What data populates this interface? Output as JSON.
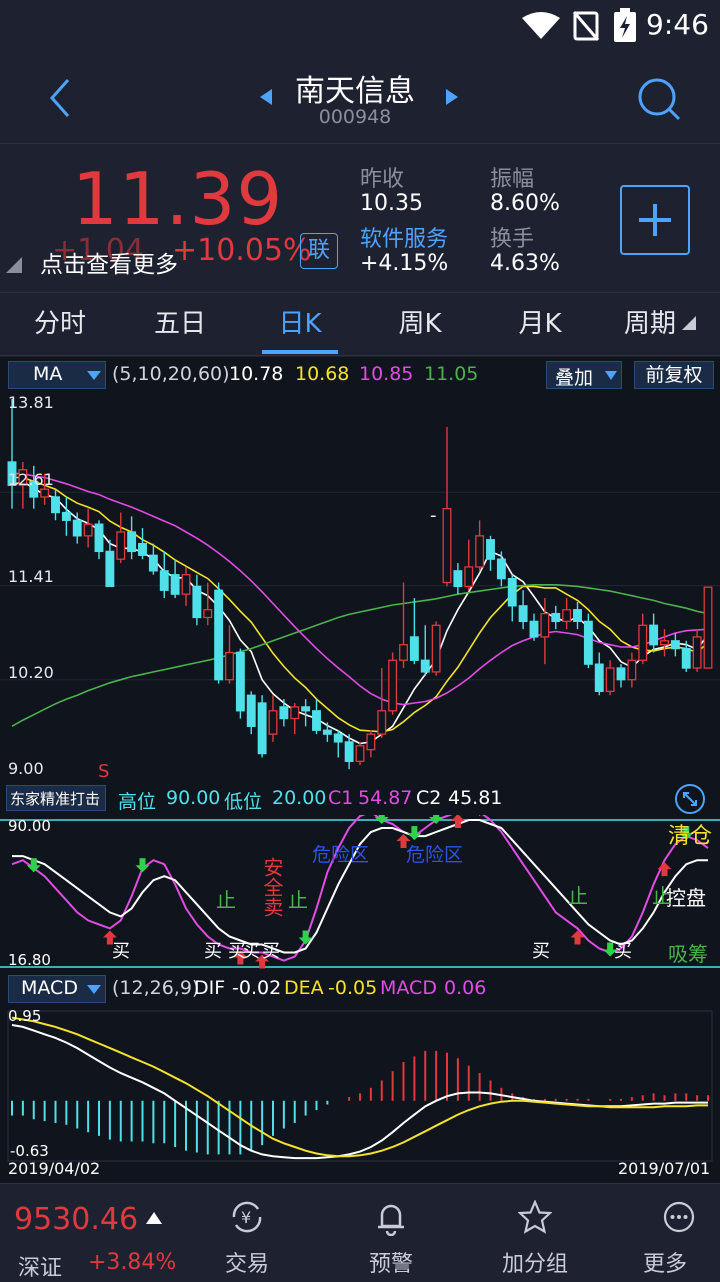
{
  "status_bar": {
    "time": "9:46"
  },
  "nav": {
    "title": "南天信息",
    "code": "000948"
  },
  "quote": {
    "price": "11.39",
    "change": "+1.04",
    "change_pct": "+10.05%",
    "link_badge": "联",
    "tooltip": "点击查看更多",
    "prev_close_label": "昨收",
    "prev_close_value": "10.35",
    "amplitude_label": "振幅",
    "amplitude_value": "8.60%",
    "sector_label": "软件服务",
    "sector_value": "+4.15%",
    "turnover_label": "换手",
    "turnover_value": "4.63%"
  },
  "tabs": [
    "分时",
    "五日",
    "日K",
    "周K",
    "月K",
    "周期"
  ],
  "active_tab": 2,
  "ma_panel": {
    "indicator": "MA",
    "params": "(5,10,20,60)",
    "ma5": "10.78",
    "ma10": "10.68",
    "ma20": "10.85",
    "ma60": "11.05",
    "overlay_btn": "叠加",
    "adjust_btn": "前复权",
    "y_labels": [
      "13.81",
      "12.61",
      "11.41",
      "10.20",
      "9.00"
    ],
    "signal_s": "S",
    "high_marker": "-"
  },
  "osc_panel": {
    "name": "东家精准打击",
    "high_label": "高位",
    "high_value": "90.00",
    "low_label": "低位",
    "low_value": "20.00",
    "c1_label": "C1",
    "c1_value": "54.87",
    "c2_label": "C2",
    "c2_value": "45.81",
    "y_top": "90.00",
    "y_bottom": "16.80",
    "tag_clear": "清仓",
    "tag_control": "控盘",
    "tag_absorb": "吸筹",
    "annotations": [
      "买",
      "买",
      "买",
      "买",
      "买",
      "买",
      "买",
      "止",
      "止",
      "止",
      "止",
      "安全卖",
      "危险区",
      "危险区"
    ]
  },
  "macd_panel": {
    "indicator": "MACD",
    "params": "(12,26,9)",
    "dif_label": "DIF",
    "dif_value": "-0.02",
    "dea_label": "DEA",
    "dea_value": "-0.05",
    "macd_label": "MACD",
    "macd_value": "0.06",
    "y_top": "0.95",
    "y_bottom": "-0.63",
    "date_start": "2019/04/02",
    "date_end": "2019/07/01"
  },
  "bottom": {
    "index_value": "9530.46",
    "index_name": "深证",
    "index_change": "+3.84%",
    "nav_items": [
      "交易",
      "预警",
      "加分组",
      "更多"
    ]
  },
  "colors": {
    "up": "#e0393e",
    "down": "#4fe0ea",
    "accent": "#4da3ff",
    "ma5": "#ffffff",
    "ma10": "#f4e22c",
    "ma20": "#e14ce6",
    "ma60": "#4bb34b"
  },
  "chart_data": [
    {
      "type": "candlestick",
      "title": "",
      "x_range": [
        "2019/04/02",
        "2019/07/01"
      ],
      "ylim": [
        9.0,
        13.81
      ],
      "ohlc": [
        [
          13.0,
          12.7,
          13.81,
          12.4
        ],
        [
          12.7,
          12.9,
          13.0,
          12.4
        ],
        [
          12.75,
          12.55,
          12.95,
          12.4
        ],
        [
          12.55,
          12.65,
          12.85,
          12.45
        ],
        [
          12.55,
          12.35,
          12.65,
          12.25
        ],
        [
          12.35,
          12.25,
          12.55,
          12.05
        ],
        [
          12.25,
          12.05,
          12.35,
          11.95
        ],
        [
          12.05,
          12.2,
          12.4,
          11.9
        ],
        [
          12.2,
          11.85,
          12.25,
          11.75
        ],
        [
          11.85,
          11.4,
          12.0,
          11.4
        ],
        [
          11.75,
          12.1,
          12.35,
          11.7
        ],
        [
          12.1,
          11.85,
          12.3,
          11.75
        ],
        [
          11.95,
          11.8,
          12.15,
          11.75
        ],
        [
          11.8,
          11.6,
          11.95,
          11.55
        ],
        [
          11.6,
          11.35,
          11.85,
          11.25
        ],
        [
          11.55,
          11.3,
          11.75,
          11.25
        ],
        [
          11.3,
          11.55,
          11.65,
          11.15
        ],
        [
          11.4,
          11.0,
          11.55,
          10.9
        ],
        [
          11.0,
          11.1,
          11.45,
          10.9
        ],
        [
          11.35,
          10.2,
          11.45,
          10.15
        ],
        [
          10.2,
          10.55,
          10.9,
          10.15
        ],
        [
          10.55,
          9.8,
          10.6,
          9.7
        ],
        [
          10.0,
          9.6,
          10.05,
          9.5
        ],
        [
          9.9,
          9.25,
          10.0,
          9.2
        ],
        [
          9.5,
          9.8,
          10.0,
          9.4
        ],
        [
          9.85,
          9.7,
          9.95,
          9.6
        ],
        [
          9.7,
          9.85,
          9.9,
          9.5
        ],
        [
          9.85,
          9.8,
          9.95,
          9.6
        ],
        [
          9.8,
          9.55,
          9.95,
          9.5
        ],
        [
          9.55,
          9.5,
          9.65,
          9.4
        ],
        [
          9.5,
          9.4,
          9.55,
          9.2
        ],
        [
          9.4,
          9.15,
          9.5,
          9.05
        ],
        [
          9.15,
          9.35,
          9.4,
          9.1
        ],
        [
          9.3,
          9.5,
          9.55,
          9.2
        ],
        [
          9.5,
          9.8,
          10.35,
          9.45
        ],
        [
          9.8,
          10.45,
          10.55,
          9.75
        ],
        [
          10.45,
          10.65,
          11.45,
          10.35
        ],
        [
          10.75,
          10.45,
          11.25,
          10.4
        ],
        [
          10.45,
          10.3,
          10.9,
          10.25
        ],
        [
          10.3,
          10.9,
          10.95,
          10.25
        ],
        [
          11.45,
          12.4,
          13.45,
          11.4
        ],
        [
          11.6,
          11.4,
          11.7,
          11.3
        ],
        [
          11.4,
          11.65,
          12.0,
          11.35
        ],
        [
          11.65,
          12.05,
          12.25,
          11.6
        ],
        [
          12.0,
          11.75,
          12.05,
          11.6
        ],
        [
          11.75,
          11.5,
          11.85,
          11.4
        ],
        [
          11.5,
          11.15,
          11.55,
          10.95
        ],
        [
          11.15,
          10.95,
          11.35,
          10.85
        ],
        [
          10.95,
          10.75,
          11.05,
          10.7
        ],
        [
          10.75,
          11.05,
          11.25,
          10.4
        ],
        [
          11.05,
          10.95,
          11.15,
          10.85
        ],
        [
          10.95,
          11.1,
          11.25,
          10.85
        ],
        [
          11.1,
          10.95,
          11.2,
          10.85
        ],
        [
          10.95,
          10.4,
          11.05,
          10.35
        ],
        [
          10.4,
          10.05,
          10.55,
          10.0
        ],
        [
          10.05,
          10.35,
          10.45,
          10.0
        ],
        [
          10.35,
          10.2,
          10.4,
          10.1
        ],
        [
          10.2,
          10.45,
          10.55,
          10.1
        ],
        [
          10.45,
          10.9,
          11.05,
          10.4
        ],
        [
          10.9,
          10.65,
          11.05,
          10.55
        ],
        [
          10.65,
          10.7,
          10.85,
          10.5
        ],
        [
          10.7,
          10.6,
          10.8,
          10.5
        ],
        [
          10.6,
          10.35,
          10.7,
          10.3
        ],
        [
          10.35,
          10.75,
          10.85,
          10.3
        ],
        [
          10.35,
          11.39,
          11.39,
          10.35
        ]
      ],
      "series": [
        {
          "name": "MA5",
          "values": [
            12.7,
            12.75,
            12.66,
            12.58,
            12.54,
            12.39,
            12.27,
            12.21,
            12.13,
            11.95,
            11.89,
            11.89,
            11.84,
            11.75,
            11.59,
            11.51,
            11.51,
            11.35,
            11.28,
            11.14,
            10.96,
            10.71,
            10.56,
            10.2,
            10.02,
            9.9,
            9.8,
            9.75,
            9.7,
            9.61,
            9.54,
            9.45,
            9.38,
            9.4,
            9.5,
            9.6,
            9.84,
            10.08,
            10.27,
            10.46,
            10.83,
            11.1,
            11.33,
            11.57,
            11.85,
            11.79,
            11.55,
            11.46,
            11.27,
            11.07,
            10.99,
            10.95,
            11.0,
            10.88,
            10.7,
            10.61,
            10.43,
            10.36,
            10.5,
            10.59,
            10.62,
            10.67,
            10.65,
            10.59,
            10.78
          ]
        },
        {
          "name": "MA10",
          "values": [
            12.8,
            12.8,
            12.75,
            12.7,
            12.65,
            12.55,
            12.47,
            12.42,
            12.36,
            12.24,
            12.16,
            12.1,
            12.0,
            11.93,
            11.84,
            11.74,
            11.66,
            11.58,
            11.5,
            11.37,
            11.23,
            11.08,
            10.94,
            10.74,
            10.54,
            10.37,
            10.22,
            10.1,
            9.95,
            9.83,
            9.71,
            9.62,
            9.55,
            9.54,
            9.53,
            9.56,
            9.66,
            9.78,
            9.87,
            9.98,
            10.18,
            10.36,
            10.58,
            10.8,
            11.0,
            11.15,
            11.3,
            11.4,
            11.4,
            11.38,
            11.38,
            11.3,
            11.22,
            11.1,
            10.95,
            10.85,
            10.7,
            10.62,
            10.58,
            10.57,
            10.6,
            10.62,
            10.6,
            10.55,
            10.68
          ]
        },
        {
          "name": "MA20",
          "values": [
            12.85,
            12.85,
            12.82,
            12.8,
            12.76,
            12.72,
            12.67,
            12.62,
            12.58,
            12.52,
            12.47,
            12.42,
            12.36,
            12.3,
            12.24,
            12.18,
            12.1,
            12.02,
            11.93,
            11.83,
            11.72,
            11.6,
            11.47,
            11.33,
            11.18,
            11.03,
            10.88,
            10.74,
            10.6,
            10.47,
            10.35,
            10.24,
            10.12,
            10.02,
            9.95,
            9.9,
            9.88,
            9.9,
            9.92,
            9.96,
            10.03,
            10.12,
            10.22,
            10.34,
            10.45,
            10.55,
            10.64,
            10.7,
            10.75,
            10.8,
            10.82,
            10.8,
            10.78,
            10.73,
            10.68,
            10.65,
            10.62,
            10.62,
            10.65,
            10.7,
            10.75,
            10.8,
            10.83,
            10.84,
            10.85
          ]
        },
        {
          "name": "MA60",
          "values": [
            9.6,
            9.68,
            9.75,
            9.82,
            9.89,
            9.95,
            10.0,
            10.06,
            10.11,
            10.16,
            10.2,
            10.24,
            10.27,
            10.3,
            10.33,
            10.36,
            10.39,
            10.42,
            10.45,
            10.48,
            10.52,
            10.56,
            10.6,
            10.65,
            10.7,
            10.75,
            10.8,
            10.85,
            10.9,
            10.95,
            11.0,
            11.04,
            11.07,
            11.1,
            11.13,
            11.16,
            11.18,
            11.2,
            11.22,
            11.24,
            11.27,
            11.3,
            11.32,
            11.34,
            11.36,
            11.38,
            11.4,
            11.41,
            11.42,
            11.42,
            11.42,
            11.41,
            11.4,
            11.38,
            11.36,
            11.34,
            11.31,
            11.28,
            11.25,
            11.22,
            11.18,
            11.15,
            11.12,
            11.08,
            11.05
          ]
        }
      ]
    },
    {
      "type": "line",
      "title": "东家精准打击",
      "ylim": [
        16.8,
        90.0
      ],
      "series": [
        {
          "name": "C1",
          "values": [
            68,
            70,
            66,
            62,
            56,
            50,
            44,
            40,
            38,
            36,
            40,
            52,
            66,
            70,
            68,
            58,
            46,
            38,
            32,
            28,
            26,
            26,
            24,
            24,
            22,
            20,
            22,
            30,
            46,
            64,
            76,
            86,
            92,
            94,
            90,
            88,
            84,
            82,
            86,
            90,
            92,
            94,
            96,
            94,
            90,
            84,
            76,
            68,
            60,
            52,
            44,
            40,
            36,
            30,
            26,
            24,
            26,
            32,
            44,
            58,
            70,
            78,
            82,
            80,
            76
          ]
        },
        {
          "name": "C2",
          "values": [
            72,
            72,
            70,
            68,
            64,
            60,
            56,
            52,
            48,
            44,
            42,
            46,
            54,
            60,
            62,
            60,
            54,
            48,
            42,
            36,
            32,
            30,
            28,
            28,
            26,
            24,
            24,
            26,
            34,
            46,
            58,
            68,
            78,
            84,
            86,
            86,
            84,
            82,
            82,
            84,
            86,
            88,
            90,
            90,
            88,
            86,
            80,
            74,
            68,
            62,
            56,
            50,
            44,
            38,
            34,
            30,
            28,
            30,
            36,
            44,
            54,
            62,
            68,
            70,
            70
          ]
        }
      ]
    },
    {
      "type": "line",
      "title": "MACD",
      "ylim": [
        -0.63,
        0.95
      ],
      "series": [
        {
          "name": "DIF",
          "values": [
            0.82,
            0.8,
            0.76,
            0.72,
            0.68,
            0.63,
            0.57,
            0.5,
            0.43,
            0.36,
            0.3,
            0.25,
            0.2,
            0.14,
            0.08,
            0.0,
            -0.08,
            -0.16,
            -0.24,
            -0.32,
            -0.4,
            -0.48,
            -0.54,
            -0.58,
            -0.6,
            -0.61,
            -0.62,
            -0.62,
            -0.62,
            -0.61,
            -0.6,
            -0.58,
            -0.55,
            -0.5,
            -0.43,
            -0.34,
            -0.24,
            -0.15,
            -0.06,
            0.0,
            0.05,
            0.08,
            0.09,
            0.09,
            0.08,
            0.06,
            0.04,
            0.02,
            0.0,
            -0.01,
            -0.02,
            -0.03,
            -0.04,
            -0.05,
            -0.06,
            -0.06,
            -0.06,
            -0.05,
            -0.04,
            -0.03,
            -0.03,
            -0.02,
            -0.02,
            -0.02,
            -0.02
          ]
        },
        {
          "name": "DEA",
          "values": [
            0.9,
            0.88,
            0.86,
            0.83,
            0.8,
            0.76,
            0.72,
            0.67,
            0.62,
            0.57,
            0.52,
            0.47,
            0.42,
            0.37,
            0.31,
            0.25,
            0.19,
            0.12,
            0.05,
            -0.03,
            -0.11,
            -0.19,
            -0.27,
            -0.34,
            -0.41,
            -0.46,
            -0.5,
            -0.54,
            -0.57,
            -0.59,
            -0.6,
            -0.6,
            -0.59,
            -0.57,
            -0.54,
            -0.5,
            -0.45,
            -0.39,
            -0.33,
            -0.27,
            -0.21,
            -0.15,
            -0.1,
            -0.06,
            -0.03,
            -0.01,
            0.0,
            0.0,
            -0.01,
            -0.02,
            -0.03,
            -0.04,
            -0.05,
            -0.06,
            -0.06,
            -0.07,
            -0.07,
            -0.07,
            -0.07,
            -0.07,
            -0.06,
            -0.06,
            -0.06,
            -0.05,
            -0.05
          ]
        }
      ]
    }
  ]
}
